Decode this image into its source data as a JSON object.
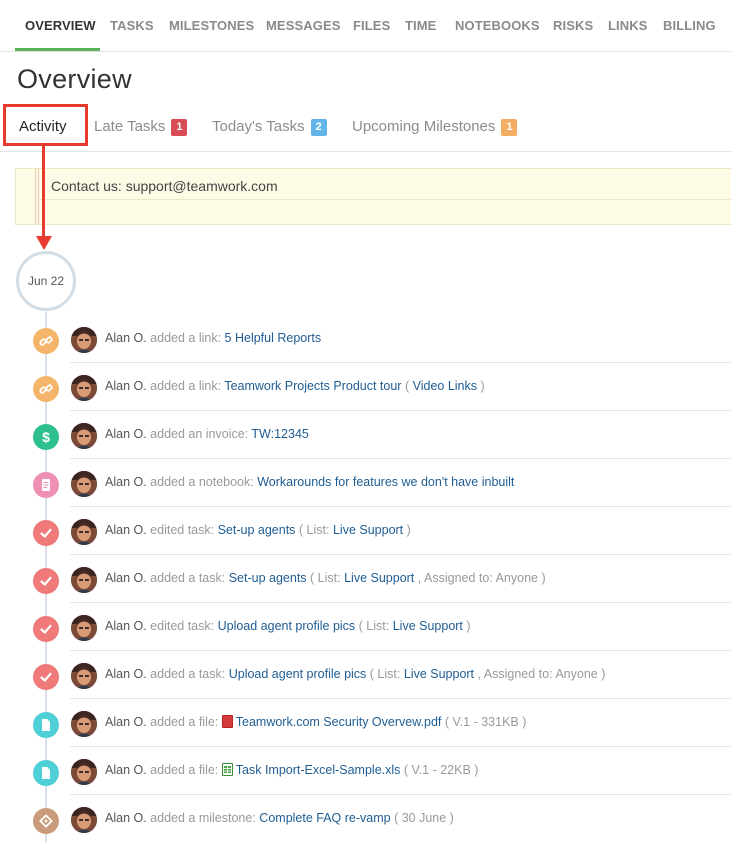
{
  "nav": {
    "items": [
      "OVERVIEW",
      "TASKS",
      "MILESTONES",
      "MESSAGES",
      "FILES",
      "TIME",
      "NOTEBOOKS",
      "RISKS",
      "LINKS",
      "BILLING"
    ]
  },
  "page": {
    "title": "Overview"
  },
  "subtabs": {
    "activity": "Activity",
    "late": "Late Tasks",
    "late_count": "1",
    "today": "Today's Tasks",
    "today_count": "2",
    "upcoming": "Upcoming Milestones",
    "upcoming_count": "1"
  },
  "notice": {
    "text": "Contact us: support@teamwork.com"
  },
  "timeline": {
    "date": "Jun 22"
  },
  "colors": {
    "link_icon": "#f4b46a",
    "invoice_icon": "#2dbf8f",
    "notebook_icon": "#ee8fb3",
    "task_icon": "#f0797a",
    "file_icon": "#4fcfd6",
    "milestone_icon": "#c99b7a",
    "badge_red": "#d84c55",
    "badge_blue": "#63b4e8",
    "badge_orange": "#f3ad63"
  },
  "activities": [
    {
      "icon": "link-icon",
      "user": "Alan O.",
      "action": "added a link:",
      "target": "5 Helpful Reports"
    },
    {
      "icon": "link-icon",
      "user": "Alan O.",
      "action": "added a link:",
      "target": "Teamwork Projects Product tour",
      "open": "(",
      "extra_link": "Video Links",
      "close": ")"
    },
    {
      "icon": "dollar-icon",
      "user": "Alan O.",
      "action": "added an invoice:",
      "target": "TW:12345"
    },
    {
      "icon": "notebook-icon",
      "user": "Alan O.",
      "action": "added a notebook:",
      "target": "Workarounds for features we don't have inbuilt"
    },
    {
      "icon": "check-icon",
      "user": "Alan O.",
      "action": "edited task:",
      "target": "Set-up agents",
      "list_prefix": "( List:",
      "list_name": "Live Support",
      "list_suffix": ")"
    },
    {
      "icon": "check-icon",
      "user": "Alan O.",
      "action": "added a task:",
      "target": "Set-up agents",
      "list_prefix": "( List:",
      "list_name": "Live Support",
      "list_suffix": ", Assigned to: Anyone )"
    },
    {
      "icon": "check-icon",
      "user": "Alan O.",
      "action": "edited task:",
      "target": "Upload agent profile pics",
      "list_prefix": "( List:",
      "list_name": "Live Support",
      "list_suffix": ")"
    },
    {
      "icon": "check-icon",
      "user": "Alan O.",
      "action": "added a task:",
      "target": "Upload agent profile pics",
      "list_prefix": "( List:",
      "list_name": "Live Support",
      "list_suffix": ", Assigned to: Anyone )"
    },
    {
      "icon": "file-icon",
      "user": "Alan O.",
      "action": "added a file:",
      "file_type": "pdf-icon",
      "target": "Teamwork.com Security Overvew.pdf",
      "meta": "( V.1 - 331KB )"
    },
    {
      "icon": "file-icon",
      "user": "Alan O.",
      "action": "added a file:",
      "file_type": "excel-icon",
      "target": "Task Import-Excel-Sample.xls",
      "meta": "( V.1 - 22KB )"
    },
    {
      "icon": "milestone-icon",
      "user": "Alan O.",
      "action": "added a milestone:",
      "target": "Complete FAQ re-vamp",
      "meta": "( 30 June )"
    }
  ]
}
